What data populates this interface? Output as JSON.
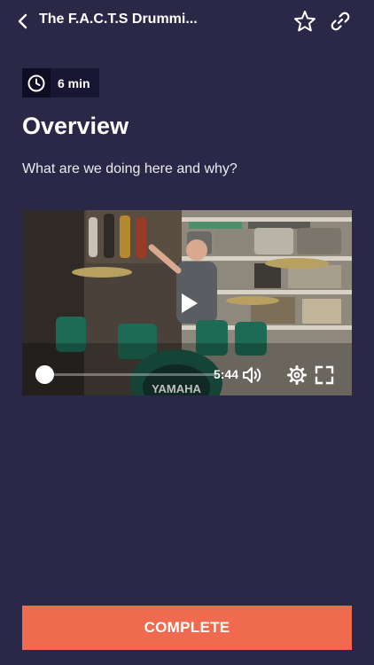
{
  "header": {
    "title": "The F.A.C.T.S Drummi...",
    "back_icon": "chevron-left-icon",
    "star_icon": "star-outline-icon",
    "link_icon": "link-icon"
  },
  "lesson": {
    "duration": "6 min",
    "duration_icon": "clock-icon",
    "title": "Overview",
    "subtitle": "What are we doing here and why?"
  },
  "video": {
    "time_remaining": "5:44",
    "progress": 0.0,
    "drum_brand": "YAMAHA",
    "play_icon": "play-icon",
    "volume_icon": "volume-icon",
    "settings_icon": "gear-icon",
    "fullscreen_icon": "fullscreen-icon"
  },
  "actions": {
    "complete_label": "COMPLETE"
  },
  "colors": {
    "background": "#2a2846",
    "badge_bg": "#181633",
    "accent": "#f06a4f"
  }
}
